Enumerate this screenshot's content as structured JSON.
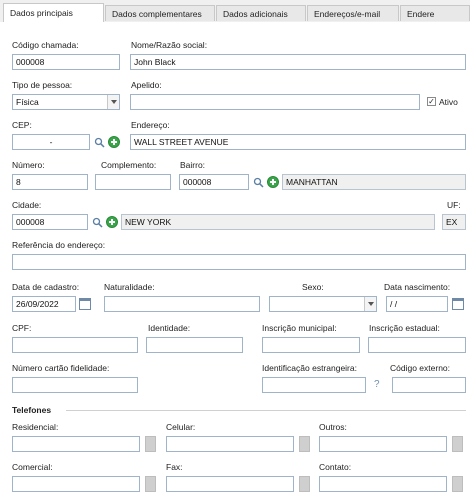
{
  "tabs": [
    "Dados principais",
    "Dados complementares",
    "Dados adicionais",
    "Endereços/e-mail",
    "Endere"
  ],
  "fields": {
    "codigo_chamada": {
      "label": "Código chamada:",
      "value": "000008"
    },
    "nome": {
      "label": "Nome/Razão social:",
      "value": "John Black"
    },
    "tipo_pessoa": {
      "label": "Tipo de pessoa:",
      "value": "Física"
    },
    "apelido": {
      "label": "Apelido:",
      "value": ""
    },
    "ativo": {
      "label": "Ativo",
      "checked": true
    },
    "cep": {
      "label": "CEP:",
      "value": "-"
    },
    "endereco": {
      "label": "Endereço:",
      "value": "WALL STREET AVENUE"
    },
    "numero": {
      "label": "Número:",
      "value": "8"
    },
    "complemento": {
      "label": "Complemento:",
      "value": ""
    },
    "bairro": {
      "label": "Bairro:",
      "code": "000008",
      "name": "MANHATTAN"
    },
    "cidade": {
      "label": "Cidade:",
      "code": "000008",
      "name": "NEW YORK"
    },
    "uf": {
      "label": "UF:",
      "value": "EX"
    },
    "referencia": {
      "label": "Referência do endereço:",
      "value": ""
    },
    "data_cadastro": {
      "label": "Data de cadastro:",
      "value": "26/09/2022"
    },
    "naturalidade": {
      "label": "Naturalidade:",
      "value": ""
    },
    "sexo": {
      "label": "Sexo:",
      "value": ""
    },
    "data_nascimento": {
      "label": "Data nascimento:",
      "value": "/ /"
    },
    "cpf": {
      "label": "CPF:",
      "value": ""
    },
    "identidade": {
      "label": "Identidade:",
      "value": ""
    },
    "inscricao_municipal": {
      "label": "Inscrição municipal:",
      "value": ""
    },
    "inscricao_estadual": {
      "label": "Inscrição estadual:",
      "value": ""
    },
    "cartao_fidelidade": {
      "label": "Número cartão fidelidade:",
      "value": ""
    },
    "identificacao_estrangeira": {
      "label": "Identificação estrangeira:",
      "value": "",
      "help": "?"
    },
    "codigo_externo": {
      "label": "Código externo:",
      "value": ""
    }
  },
  "telefones": {
    "title": "Telefones",
    "residencial": "Residencial:",
    "celular": "Celular:",
    "outros": "Outros:",
    "comercial": "Comercial:",
    "fax": "Fax:",
    "contato": "Contato:"
  },
  "icons": {
    "search": "search-icon",
    "add": "add-icon",
    "calendar": "calendar-icon",
    "dropdown": "chevron-down-icon",
    "check": "check-icon"
  },
  "colors": {
    "add": "#3aa64a",
    "input_border": "#9fb4c9",
    "readonly_bg": "#f0f0f0"
  }
}
